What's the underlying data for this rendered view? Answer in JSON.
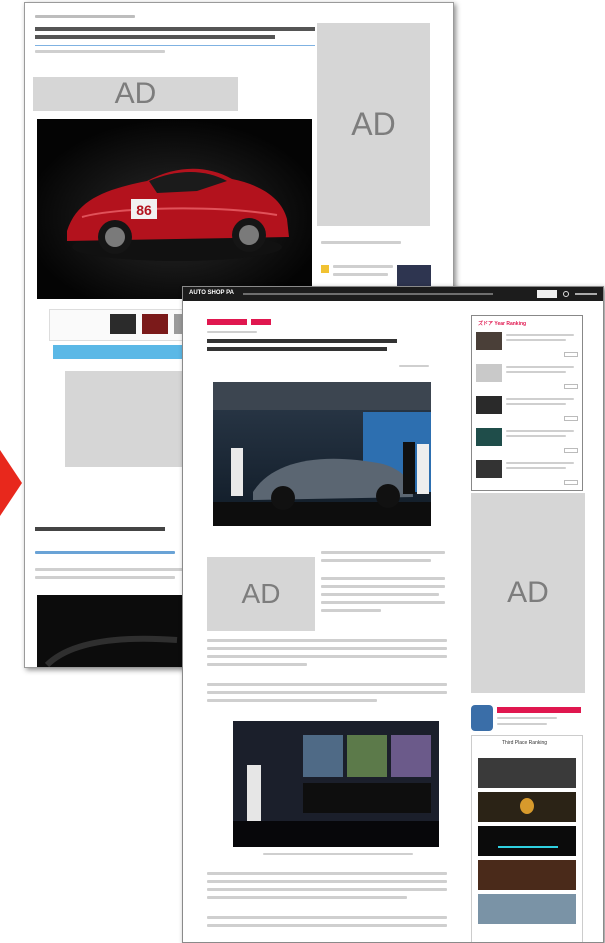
{
  "ad_label": "AD",
  "colors": {
    "accent": "#e0174f",
    "arrow": "#e8281c",
    "ad_box": "#d6d6d6",
    "ad_text": "#7d7d7d",
    "link_blue": "#6aa3d6",
    "navbar": "#1c1c1c"
  },
  "back_page": {
    "partial_ad_label": "A"
  },
  "front_page": {
    "site_logo": "AUTO SHOP PA",
    "ranking_title": "ズドア Year Ranking",
    "sidebar_heading": "Third Place Ranking"
  }
}
